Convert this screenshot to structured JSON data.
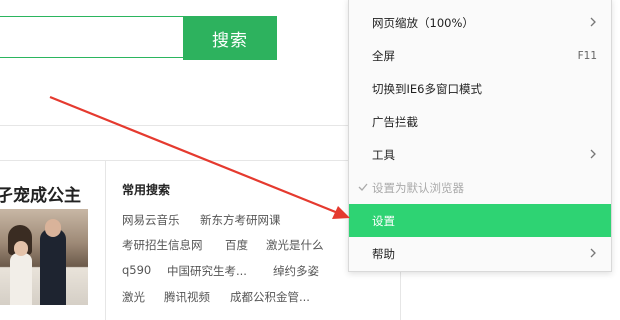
{
  "search": {
    "input_value": "",
    "button_label": "搜索"
  },
  "article": {
    "title": "孑宠成公主"
  },
  "common_search": {
    "title": "常用搜索",
    "keywords": [
      "网易云音乐",
      "新东方考研网课",
      "考研招生信息网",
      "百度",
      "激光是什么",
      "q590",
      "中国研究生考...",
      "绰约多姿",
      "激光",
      "腾讯视频",
      "成都公积金管..."
    ]
  },
  "menu": {
    "items": [
      {
        "label": "网页缩放（100%）",
        "submenu": true
      },
      {
        "label": "全屏",
        "shortcut": "F11"
      },
      {
        "label": "切换到IE6多窗口模式"
      },
      {
        "label": "广告拦截"
      },
      {
        "label": "工具",
        "submenu": true
      },
      {
        "label": "设置为默认浏览器",
        "disabled": true,
        "checked": true
      },
      {
        "label": "设置",
        "highlighted": true
      },
      {
        "label": "帮助",
        "submenu": true
      }
    ]
  },
  "colors": {
    "accent_green": "#2db25e",
    "menu_highlight": "#2ed373",
    "annotation_arrow": "#e53a2f"
  },
  "icons": {
    "submenu": "chevron-right-icon",
    "checked": "checkmark-icon"
  }
}
